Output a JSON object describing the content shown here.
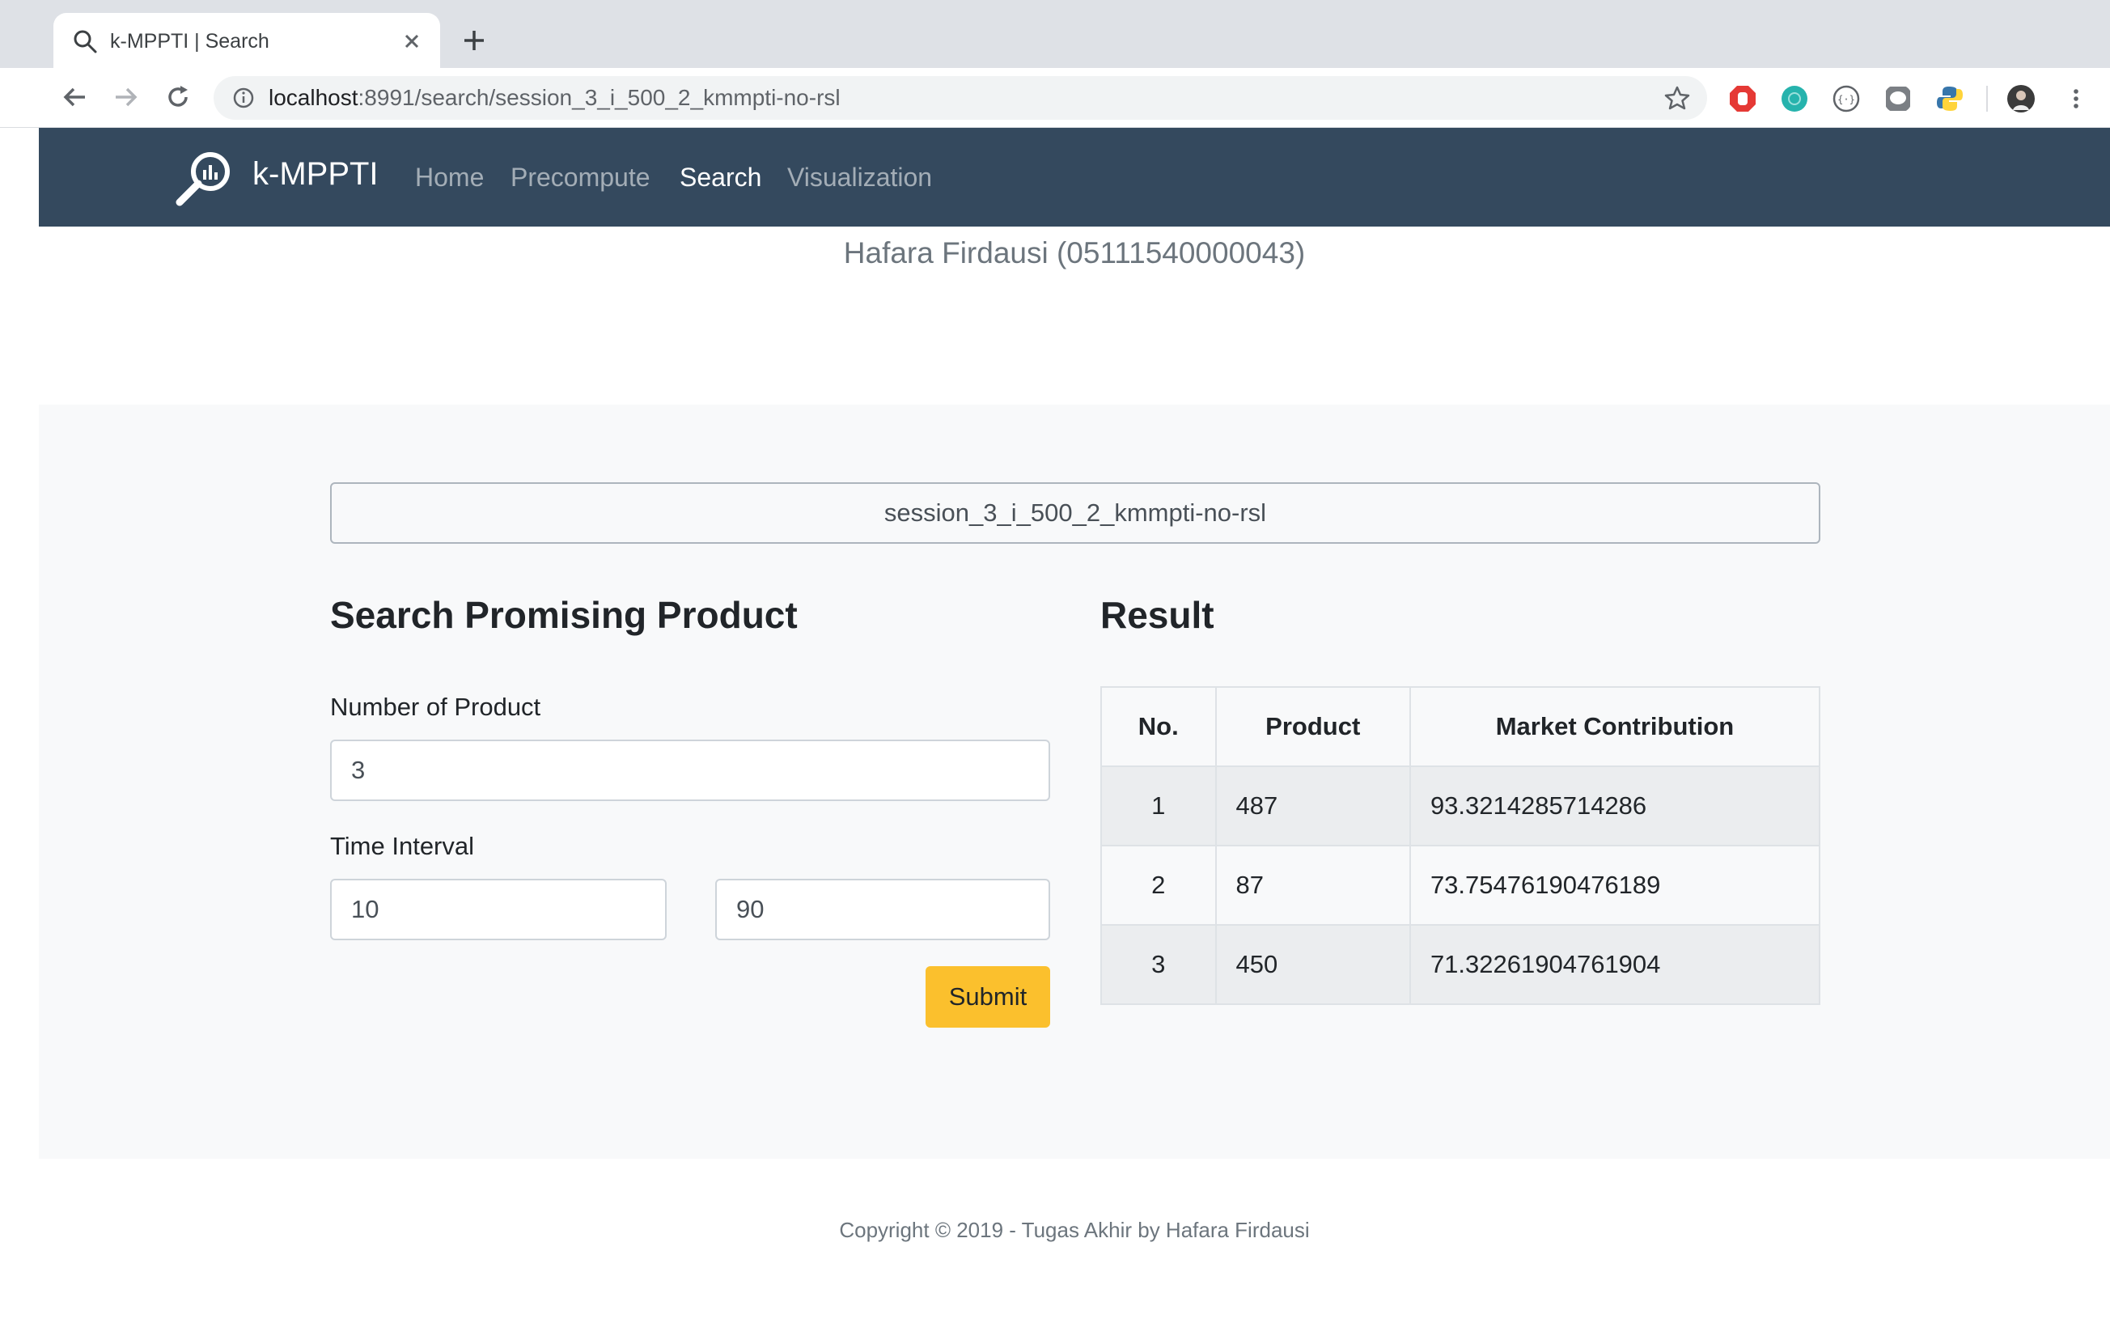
{
  "browser": {
    "tab_title": "k-MPPTI | Search",
    "url_host": "localhost",
    "url_path": ":8991/search/session_3_i_500_2_kmmpti-no-rsl",
    "extensions": [
      "adblock-icon",
      "mendeley-icon",
      "json-viewer-icon",
      "line-icon",
      "python-icon"
    ]
  },
  "navbar": {
    "brand": "k-MPPTI",
    "links": [
      {
        "label": "Home",
        "active": false
      },
      {
        "label": "Precompute",
        "active": false
      },
      {
        "label": "Search",
        "active": true
      },
      {
        "label": "Visualization",
        "active": false
      }
    ]
  },
  "author": "Hafara Firdausi (05111540000043)",
  "session": {
    "value": "session_3_i_500_2_kmmpti-no-rsl"
  },
  "search_form": {
    "title": "Search Promising Product",
    "number_label": "Number of Product",
    "number_value": "3",
    "interval_label": "Time Interval",
    "interval_start": "10",
    "interval_end": "90",
    "submit_label": "Submit"
  },
  "result": {
    "title": "Result",
    "columns": [
      "No.",
      "Product",
      "Market Contribution"
    ],
    "rows": [
      [
        "1",
        "487",
        "93.3214285714286"
      ],
      [
        "2",
        "87",
        "73.75476190476189"
      ],
      [
        "3",
        "450",
        "71.32261904761904"
      ]
    ]
  },
  "footer": "Copyright © 2019 - Tugas Akhir by Hafara Firdausi",
  "colors": {
    "navbar": "#34495e",
    "submit": "#fbc02d",
    "section_bg": "#f8f9fa"
  }
}
